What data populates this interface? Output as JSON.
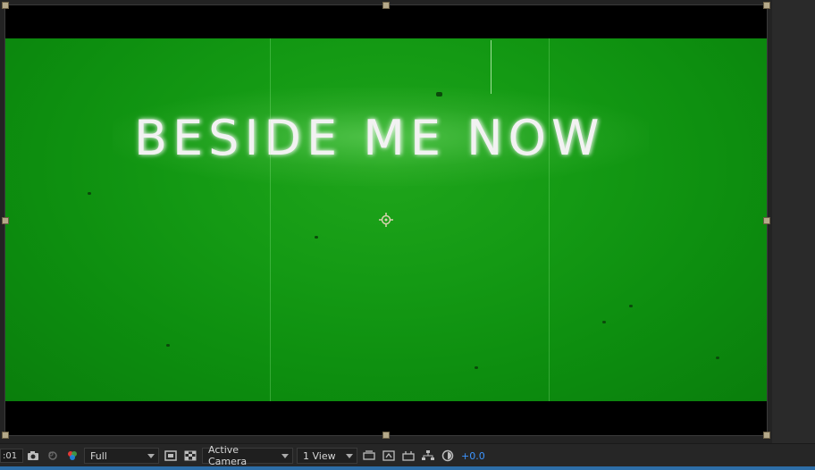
{
  "viewer": {
    "title_text": "BESIDE ME NOW",
    "background_color": "#129a12",
    "letterbox_color": "#000000"
  },
  "toolbar": {
    "timecode": ":01",
    "resolution": "Full",
    "camera": "Active Camera",
    "views": "1 View",
    "exposure": "+0.0",
    "icons": [
      "snapshot-icon",
      "show-snapshot-icon",
      "color-channels-icon",
      "region-of-interest-icon",
      "transparency-grid-icon",
      "fast-preview-icon",
      "timeline-icon",
      "comp-flowchart-icon",
      "flowchart-icon",
      "reset-exposure-icon"
    ]
  },
  "colors": {
    "accent": "#3d95ff",
    "panel": "#262626"
  }
}
